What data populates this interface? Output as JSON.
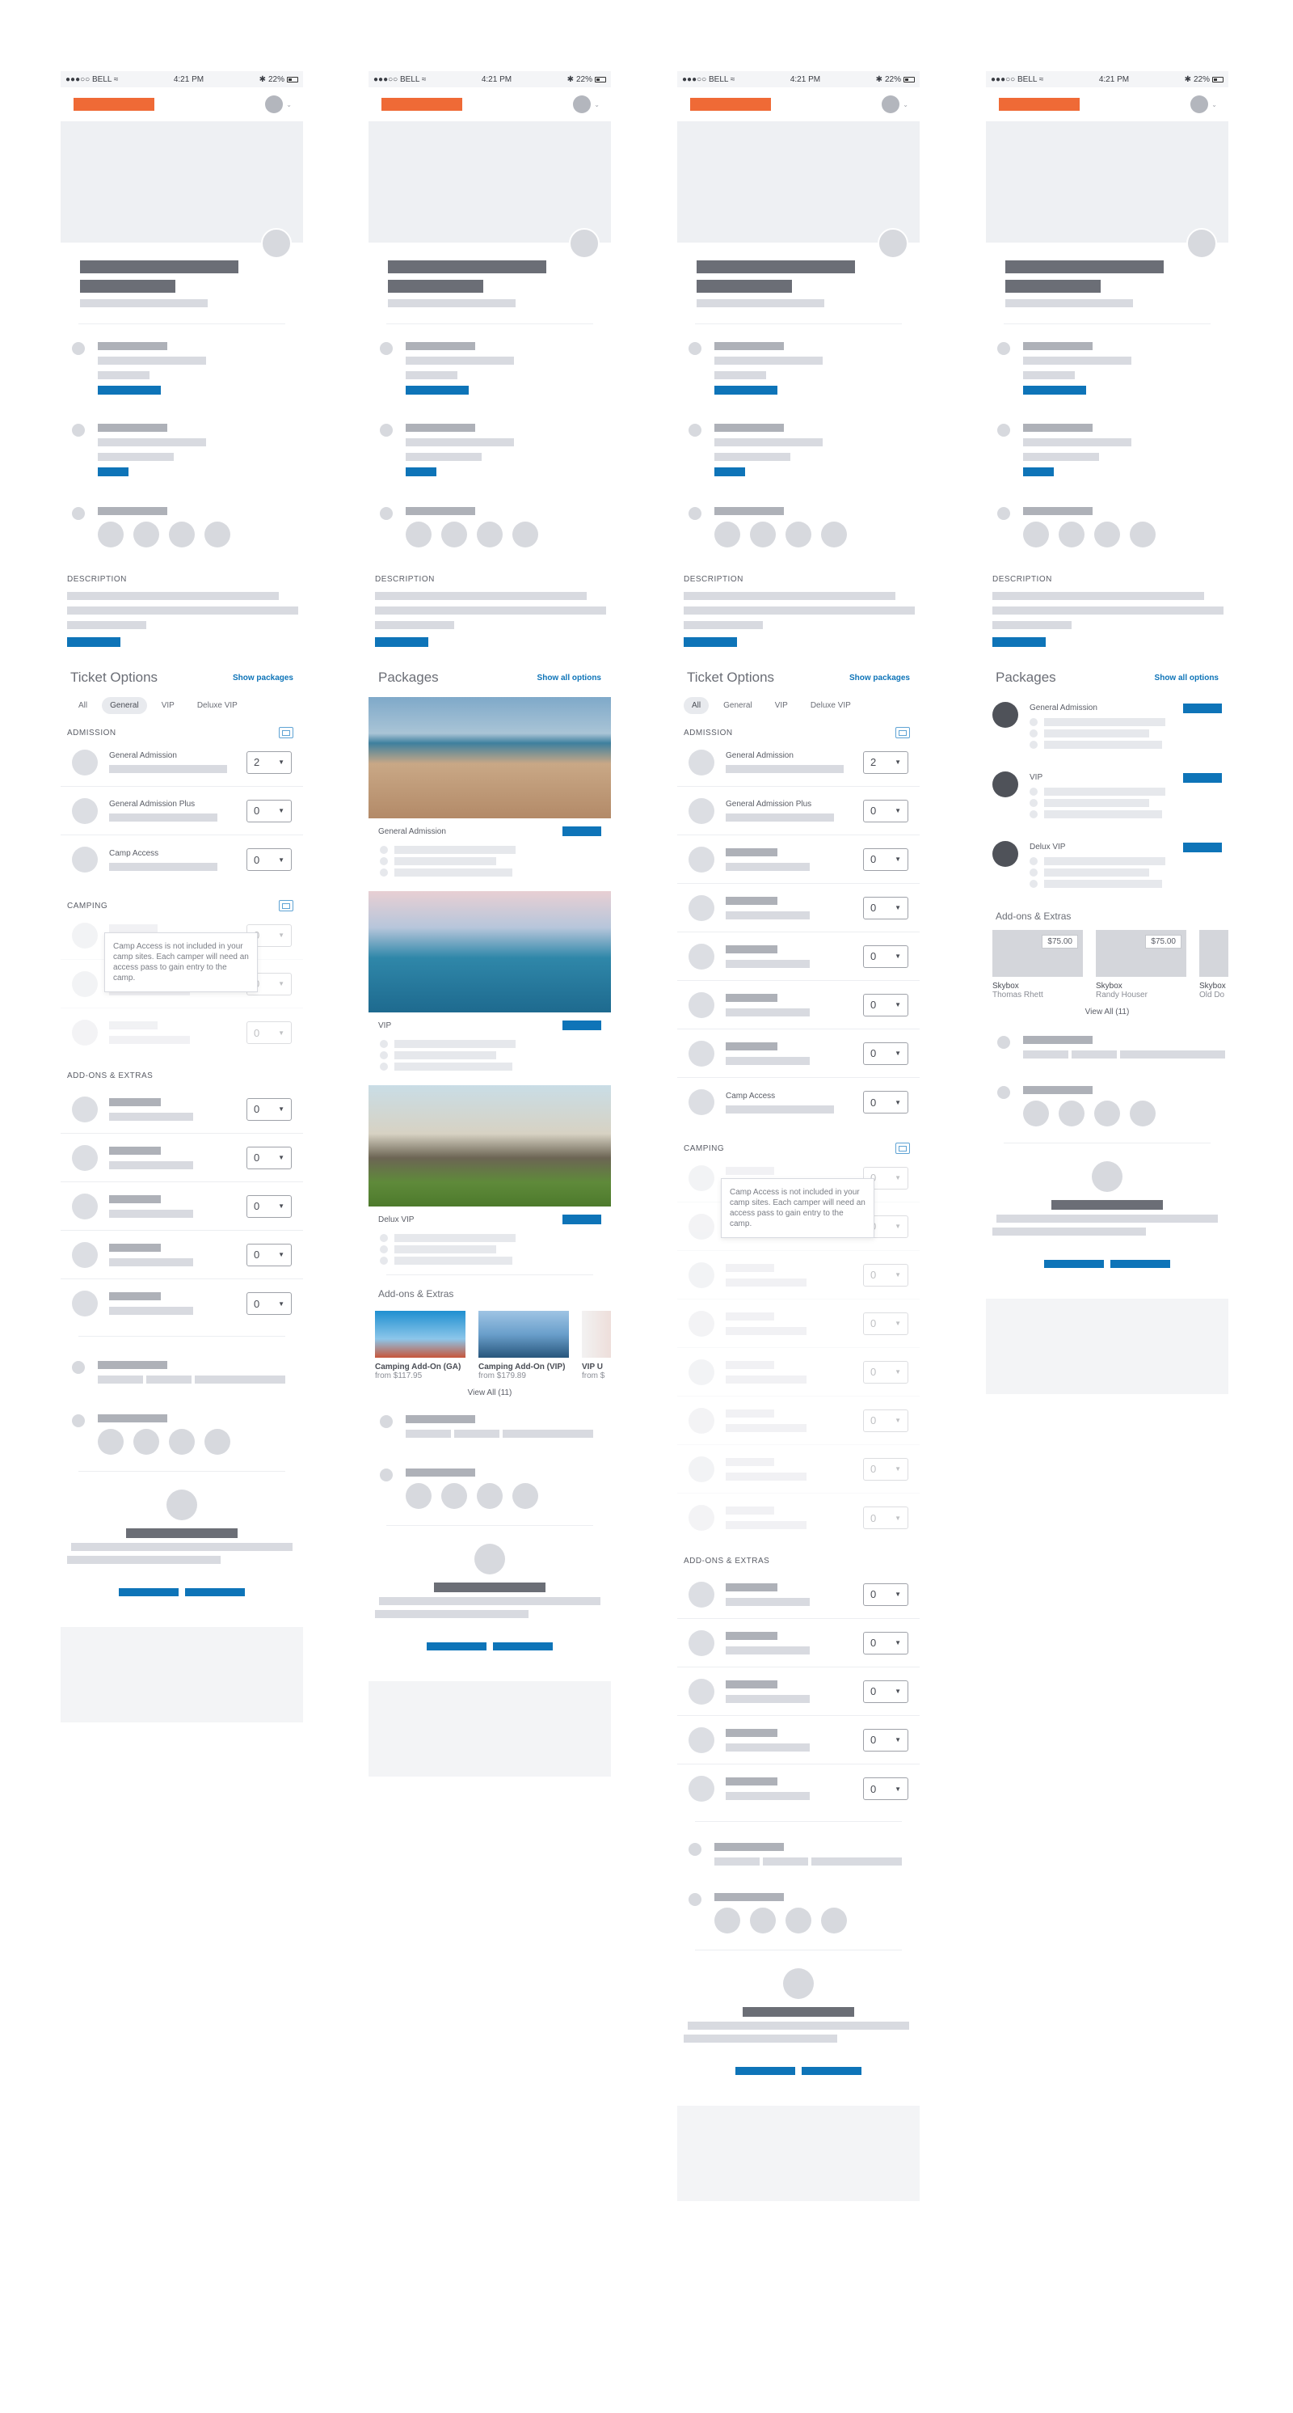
{
  "status": {
    "carrier": "BELL",
    "time": "4:21 PM",
    "battery": "22%"
  },
  "section_labels": {
    "description": "DESCRIPTION",
    "admission": "ADMISSION",
    "camping": "CAMPING",
    "addons": "ADD-ONS & EXTRAS"
  },
  "ticket_options": {
    "title": "Ticket Options",
    "link": "Show packages"
  },
  "packages_header": {
    "title": "Packages",
    "link": "Show all options"
  },
  "tabs": [
    "All",
    "General",
    "VIP",
    "Deluxe VIP"
  ],
  "tickets": {
    "general_admission": {
      "name": "General Admission",
      "qty": "2"
    },
    "general_admission_plus": {
      "name": "General Admission Plus",
      "qty": "0"
    },
    "camp_access": {
      "name": "Camp Access",
      "qty": "0"
    },
    "zero": "0"
  },
  "camp_tooltip": "Camp Access is not included in your camp sites. Each camper will need an access pass to gain entry to the camp.",
  "packages": [
    {
      "name": "General Admission"
    },
    {
      "name": "VIP"
    },
    {
      "name": "Delux VIP"
    }
  ],
  "addons_block": {
    "title": "Add-ons & Extras",
    "view_all": "View All (11)"
  },
  "addons": [
    {
      "title": "Camping Add-On (GA)",
      "price": "from $117.95"
    },
    {
      "title": "Camping Add-On (VIP)",
      "price": "from $179.89"
    },
    {
      "title": "VIP U",
      "price": "from $"
    }
  ],
  "skyboxes": [
    {
      "title": "Skybox",
      "host": "Thomas Rhett",
      "price": "$75.00"
    },
    {
      "title": "Skybox",
      "host": "Randy Houser",
      "price": "$75.00"
    },
    {
      "title": "Skybox",
      "host": "Old Do"
    }
  ],
  "colors": {
    "brand": "#ef6a36",
    "accent": "#0e74b8",
    "dark": "#6b6e76"
  }
}
